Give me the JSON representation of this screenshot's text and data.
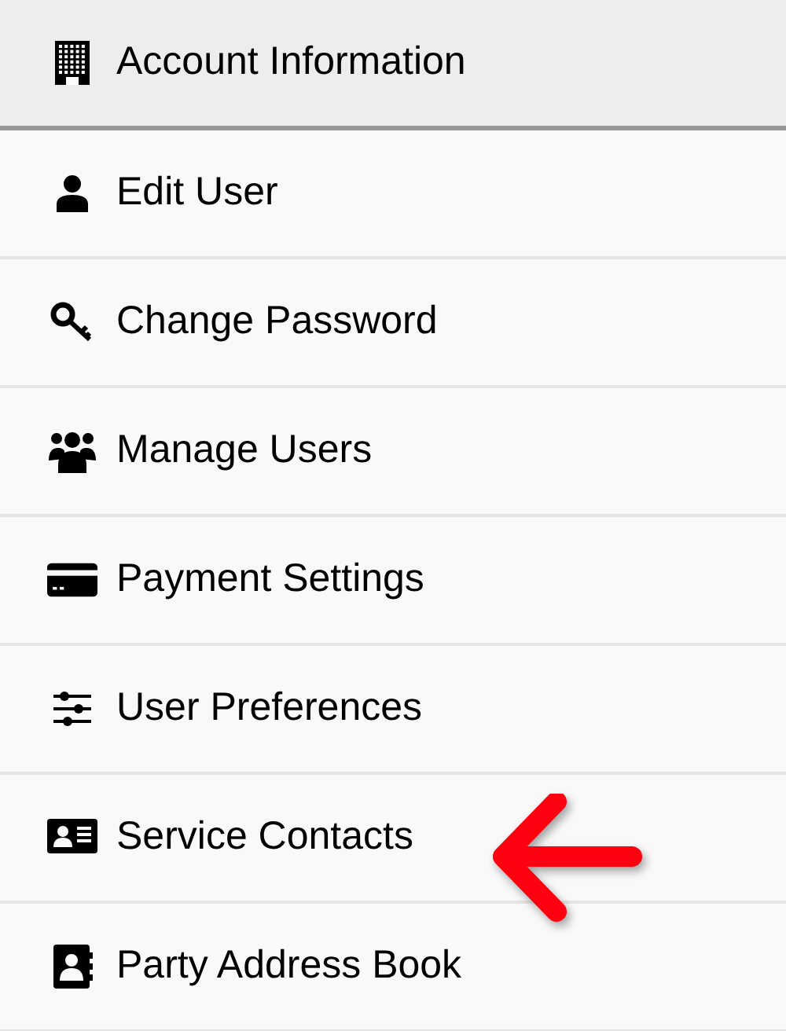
{
  "header": {
    "label": "Account Information",
    "kind": "building"
  },
  "items": [
    {
      "label": "Edit User",
      "kind": "user",
      "marked": false
    },
    {
      "label": "Change Password",
      "kind": "key",
      "marked": false
    },
    {
      "label": "Manage Users",
      "kind": "users",
      "marked": false
    },
    {
      "label": "Payment Settings",
      "kind": "card",
      "marked": false
    },
    {
      "label": "User Preferences",
      "kind": "sliders",
      "marked": false
    },
    {
      "label": "Service Contacts",
      "kind": "contact-card",
      "marked": true
    },
    {
      "label": "Party Address Book",
      "kind": "address-book",
      "marked": false
    }
  ]
}
